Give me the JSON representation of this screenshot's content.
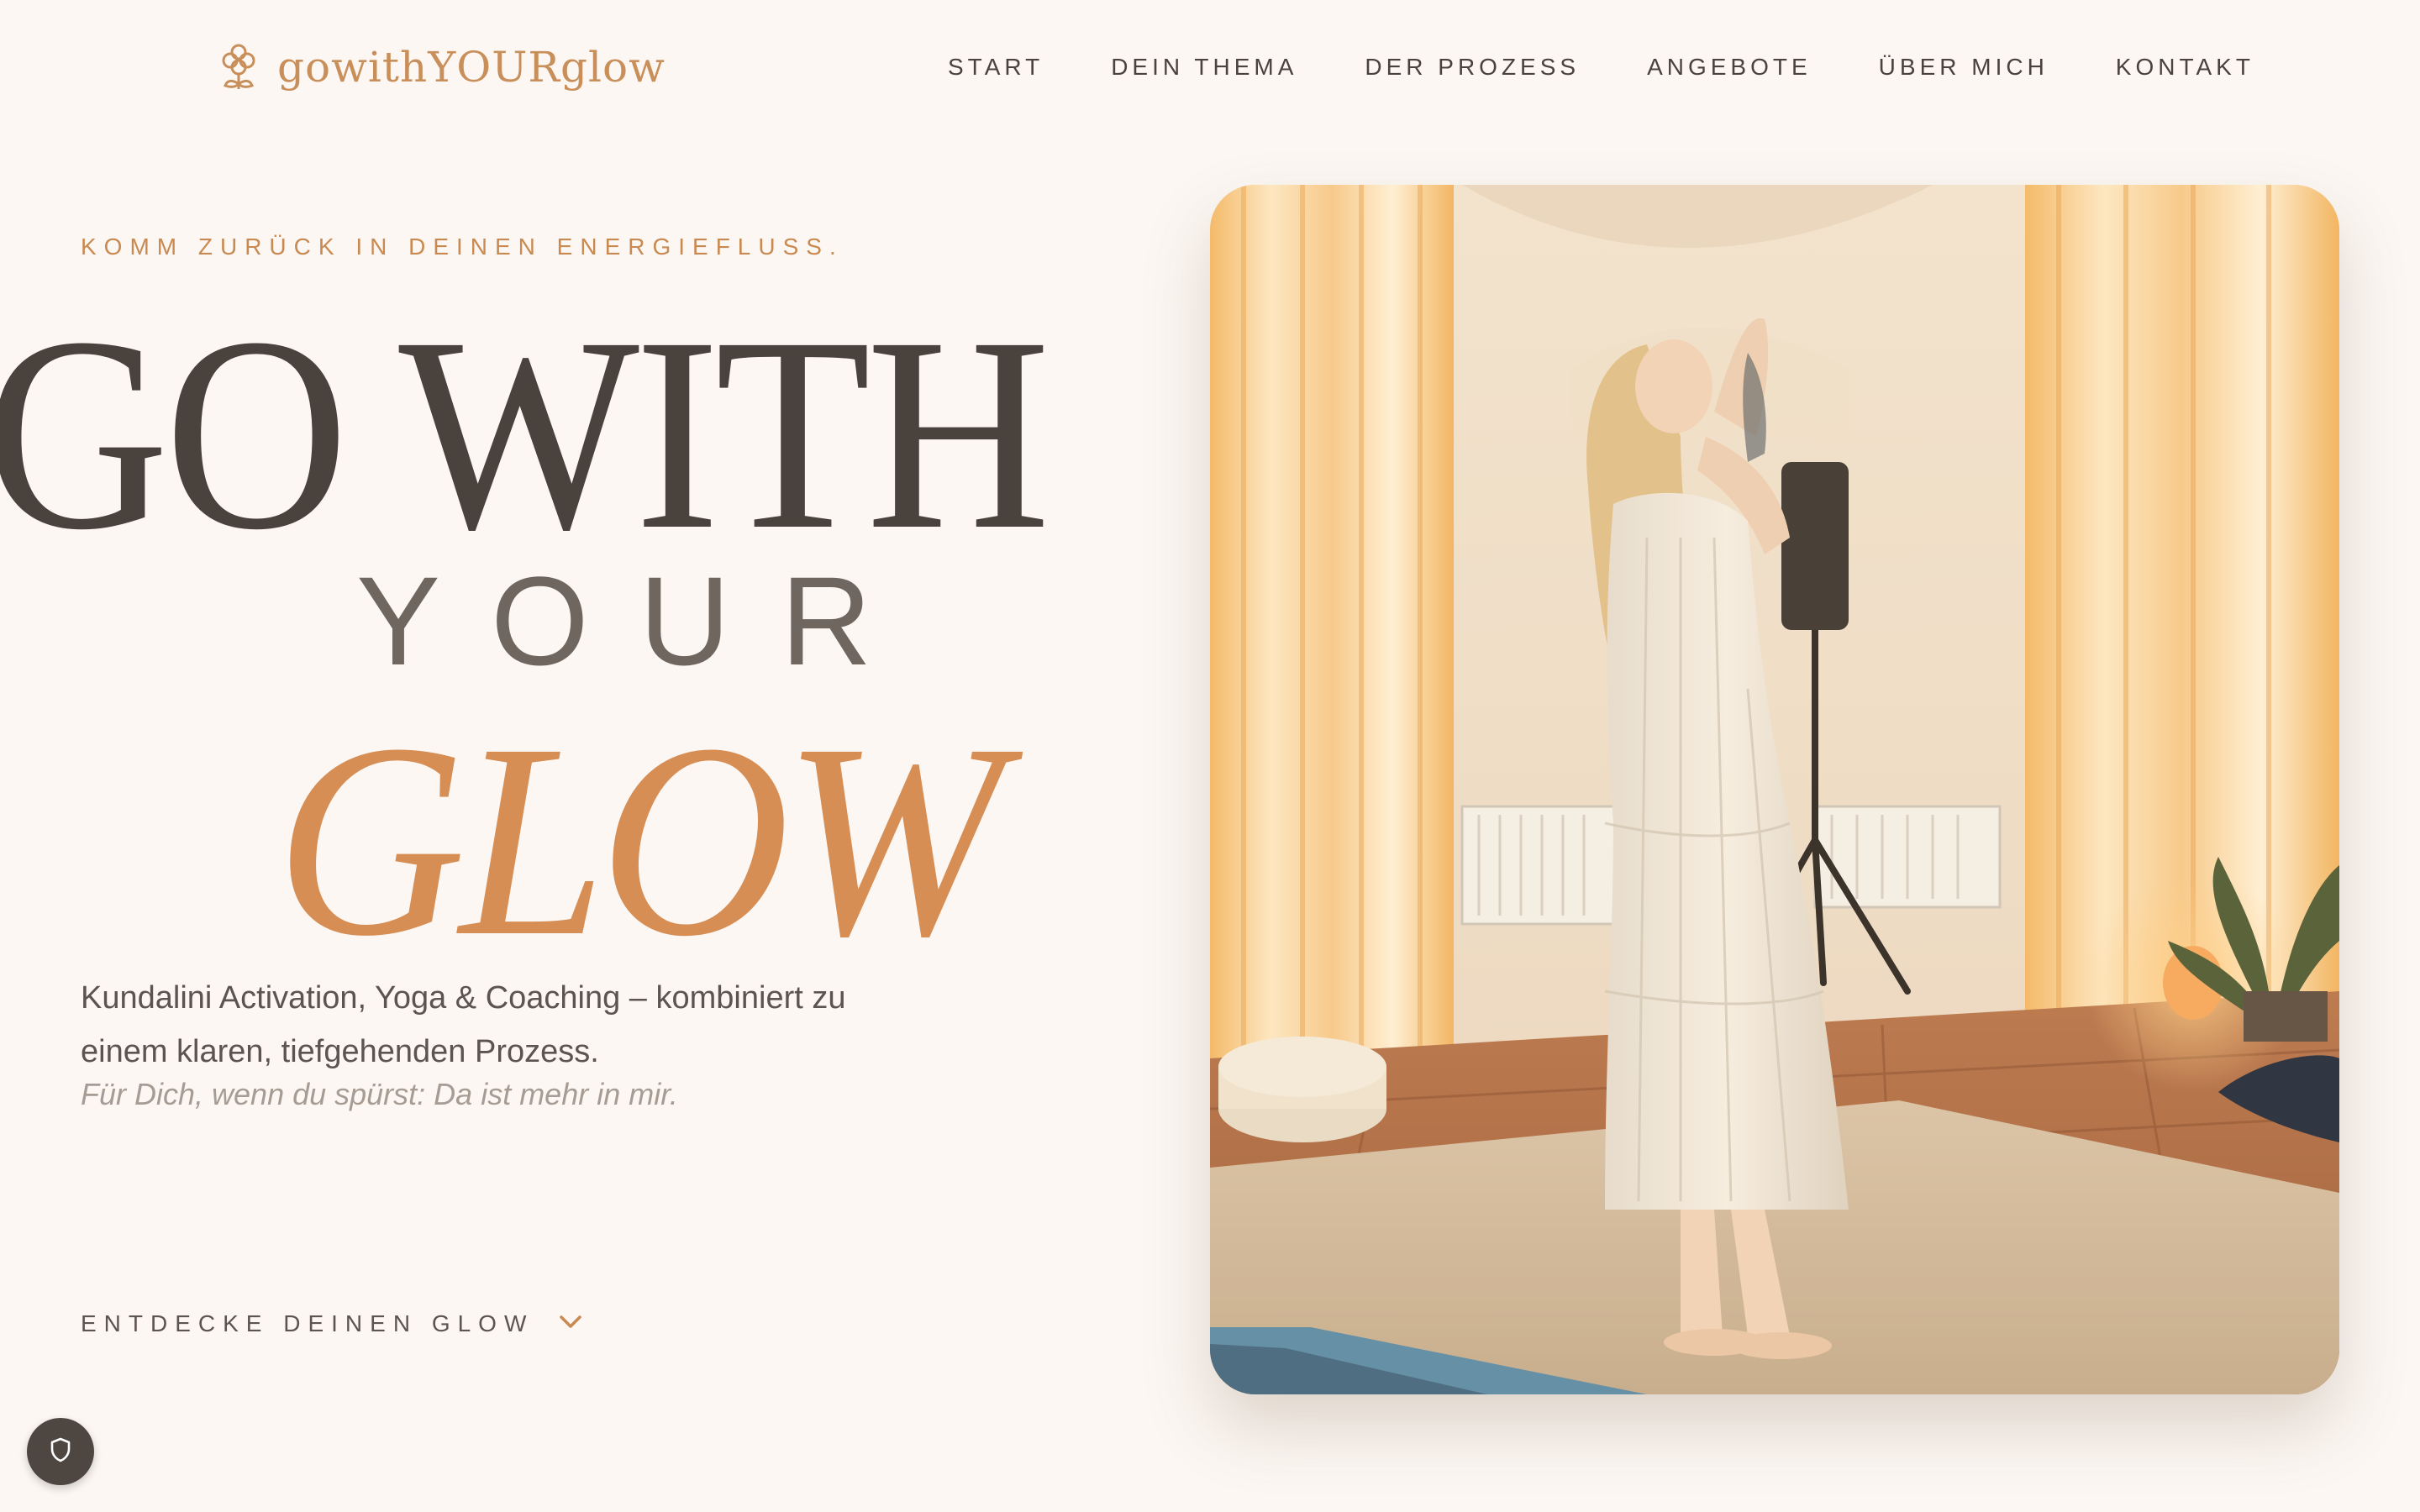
{
  "brand": {
    "name": "gowithYOURglow",
    "icon": "flower-icon"
  },
  "nav": {
    "items": [
      {
        "label": "START"
      },
      {
        "label": "DEIN THEMA"
      },
      {
        "label": "DER PROZESS"
      },
      {
        "label": "ANGEBOTE"
      },
      {
        "label": "ÜBER MICH"
      },
      {
        "label": "KONTAKT"
      }
    ]
  },
  "hero": {
    "eyebrow": "KOMM ZURÜCK IN DEINEN ENERGIEFLUSS.",
    "title_line1": "GO WITH",
    "title_line2": "YOUR",
    "title_line3": "GLOW",
    "lead": "Kundalini Activation, Yoga & Coaching – kombiniert zu einem klaren, tiefgehenden Prozess.",
    "sublead": "Für Dich, wenn du spürst: Da ist mehr in mir.",
    "cta_label": "ENTDECKE DEINEN GLOW",
    "cta_icon": "chevron-down-icon",
    "image_alt": "Frau in weißem Kleid steht in Gebetshaltung in einem hellen Yogaraum"
  },
  "privacy": {
    "icon": "shield-icon"
  },
  "colors": {
    "background": "#fcf7f3",
    "text_dark": "#4a423c",
    "accent": "#d68e55",
    "accent_light": "#c98f5a",
    "muted": "#a69c94"
  }
}
